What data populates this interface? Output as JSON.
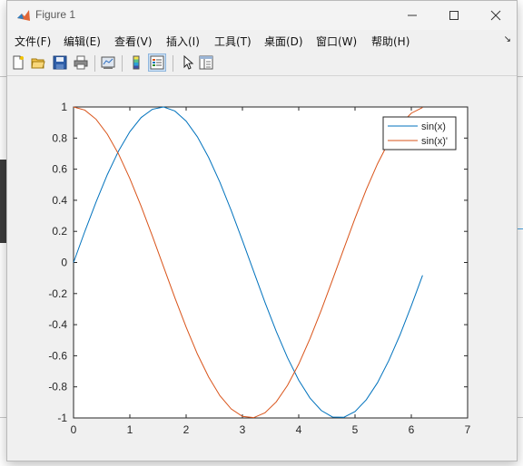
{
  "window": {
    "title": "Figure 1"
  },
  "menu": [
    "文件(F)",
    "编辑(E)",
    "查看(V)",
    "插入(I)",
    "工具(T)",
    "桌面(D)",
    "窗口(W)",
    "帮助(H)"
  ],
  "toolbar": {
    "icons": [
      "new-figure-icon",
      "open-file-icon",
      "save-icon",
      "print-icon",
      "link-plot-icon",
      "colorbar-icon",
      "legend-icon",
      "edit-plot-icon",
      "property-inspector-icon"
    ]
  },
  "colors": {
    "series1": "#0072BD",
    "series2": "#D95319"
  },
  "chart_data": {
    "type": "line",
    "xlim": [
      0,
      7
    ],
    "ylim": [
      -1,
      1
    ],
    "xticks": [
      "0",
      "1",
      "2",
      "3",
      "4",
      "5",
      "6",
      "7"
    ],
    "yticks": [
      "1",
      "0.8",
      "0.6",
      "0.4",
      "0.2",
      "0",
      "-0.2",
      "-0.4",
      "-0.6",
      "-0.8",
      "-1"
    ],
    "legend_position": "top-right",
    "grid": false,
    "series": [
      {
        "name": "sin(x)",
        "x": [
          0,
          0.2,
          0.4,
          0.6,
          0.8,
          1.0,
          1.2,
          1.4,
          1.6,
          1.8,
          2.0,
          2.2,
          2.4,
          2.6,
          2.8,
          3.0,
          3.2,
          3.4,
          3.6,
          3.8,
          4.0,
          4.2,
          4.4,
          4.6,
          4.8,
          5.0,
          5.2,
          5.4,
          5.6,
          5.8,
          6.0,
          6.2
        ],
        "y": [
          0,
          0.199,
          0.389,
          0.565,
          0.717,
          0.841,
          0.932,
          0.985,
          1.0,
          0.974,
          0.909,
          0.808,
          0.675,
          0.516,
          0.335,
          0.141,
          -0.058,
          -0.256,
          -0.443,
          -0.612,
          -0.757,
          -0.872,
          -0.952,
          -0.994,
          -0.996,
          -0.959,
          -0.883,
          -0.773,
          -0.631,
          -0.465,
          -0.279,
          -0.083
        ]
      },
      {
        "name": "sin(x)'",
        "x": [
          0,
          0.2,
          0.4,
          0.6,
          0.8,
          1.0,
          1.2,
          1.4,
          1.6,
          1.8,
          2.0,
          2.2,
          2.4,
          2.6,
          2.8,
          3.0,
          3.2,
          3.4,
          3.6,
          3.8,
          4.0,
          4.2,
          4.4,
          4.6,
          4.8,
          5.0,
          5.2,
          5.4,
          5.6,
          5.8,
          6.0,
          6.2
        ],
        "y": [
          1.0,
          0.98,
          0.921,
          0.825,
          0.697,
          0.54,
          0.362,
          0.17,
          -0.029,
          -0.227,
          -0.416,
          -0.589,
          -0.737,
          -0.857,
          -0.942,
          -0.99,
          -0.998,
          -0.967,
          -0.897,
          -0.791,
          -0.654,
          -0.49,
          -0.307,
          -0.112,
          0.087,
          0.284,
          0.469,
          0.635,
          0.776,
          0.886,
          0.96,
          0.997
        ]
      }
    ]
  }
}
